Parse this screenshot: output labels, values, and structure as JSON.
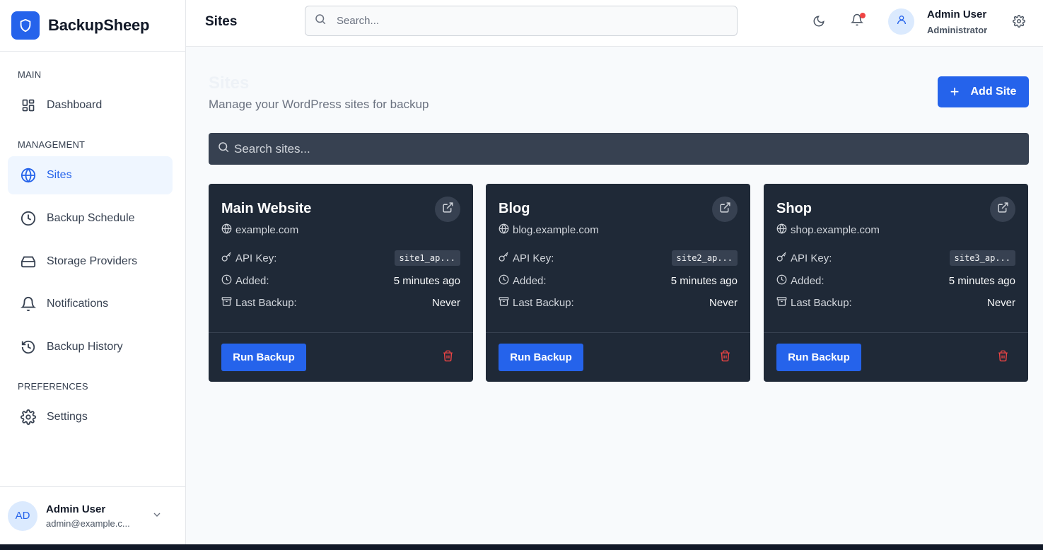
{
  "app": {
    "name": "BackupSheep"
  },
  "sidebar": {
    "sections": [
      {
        "label": "MAIN"
      },
      {
        "label": "MANAGEMENT"
      },
      {
        "label": "PREFERENCES"
      }
    ],
    "items": [
      {
        "label": "Dashboard",
        "icon": "dashboard-icon"
      },
      {
        "label": "Sites",
        "icon": "globe-icon",
        "active": true
      },
      {
        "label": "Backup Schedule",
        "icon": "clock-icon"
      },
      {
        "label": "Storage Providers",
        "icon": "hard-drive-icon"
      },
      {
        "label": "Notifications",
        "icon": "bell-icon"
      },
      {
        "label": "Backup History",
        "icon": "history-icon"
      },
      {
        "label": "Settings",
        "icon": "gear-icon"
      }
    ],
    "footer": {
      "initials": "AD",
      "name": "Admin User",
      "email": "admin@example.c..."
    }
  },
  "header": {
    "title": "Sites",
    "search_placeholder": "Search...",
    "user": {
      "name": "Admin User",
      "role": "Administrator"
    }
  },
  "main": {
    "title": "Sites",
    "subtitle": "Manage your WordPress sites for backup",
    "add_button": "Add Site",
    "search_placeholder": "Search sites...",
    "labels": {
      "api_key": "API Key:",
      "added": "Added:",
      "last_backup": "Last Backup:",
      "run_backup": "Run Backup"
    },
    "sites": [
      {
        "name": "Main Website",
        "url": "example.com",
        "api_key": "site1_ap...",
        "added": "5 minutes ago",
        "last_backup": "Never"
      },
      {
        "name": "Blog",
        "url": "blog.example.com",
        "api_key": "site2_ap...",
        "added": "5 minutes ago",
        "last_backup": "Never"
      },
      {
        "name": "Shop",
        "url": "shop.example.com",
        "api_key": "site3_ap...",
        "added": "5 minutes ago",
        "last_backup": "Never"
      }
    ]
  },
  "colors": {
    "accent": "#2563eb",
    "danger": "#ef4444",
    "card_bg": "#1f2937"
  }
}
